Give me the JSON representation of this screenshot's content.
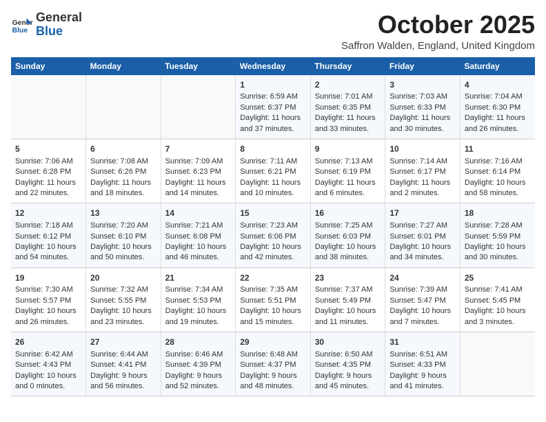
{
  "header": {
    "logo_general": "General",
    "logo_blue": "Blue",
    "month": "October 2025",
    "location": "Saffron Walden, England, United Kingdom"
  },
  "days_of_week": [
    "Sunday",
    "Monday",
    "Tuesday",
    "Wednesday",
    "Thursday",
    "Friday",
    "Saturday"
  ],
  "weeks": [
    [
      {
        "day": "",
        "text": ""
      },
      {
        "day": "",
        "text": ""
      },
      {
        "day": "",
        "text": ""
      },
      {
        "day": "1",
        "text": "Sunrise: 6:59 AM\nSunset: 6:37 PM\nDaylight: 11 hours and 37 minutes."
      },
      {
        "day": "2",
        "text": "Sunrise: 7:01 AM\nSunset: 6:35 PM\nDaylight: 11 hours and 33 minutes."
      },
      {
        "day": "3",
        "text": "Sunrise: 7:03 AM\nSunset: 6:33 PM\nDaylight: 11 hours and 30 minutes."
      },
      {
        "day": "4",
        "text": "Sunrise: 7:04 AM\nSunset: 6:30 PM\nDaylight: 11 hours and 26 minutes."
      }
    ],
    [
      {
        "day": "5",
        "text": "Sunrise: 7:06 AM\nSunset: 6:28 PM\nDaylight: 11 hours and 22 minutes."
      },
      {
        "day": "6",
        "text": "Sunrise: 7:08 AM\nSunset: 6:26 PM\nDaylight: 11 hours and 18 minutes."
      },
      {
        "day": "7",
        "text": "Sunrise: 7:09 AM\nSunset: 6:23 PM\nDaylight: 11 hours and 14 minutes."
      },
      {
        "day": "8",
        "text": "Sunrise: 7:11 AM\nSunset: 6:21 PM\nDaylight: 11 hours and 10 minutes."
      },
      {
        "day": "9",
        "text": "Sunrise: 7:13 AM\nSunset: 6:19 PM\nDaylight: 11 hours and 6 minutes."
      },
      {
        "day": "10",
        "text": "Sunrise: 7:14 AM\nSunset: 6:17 PM\nDaylight: 11 hours and 2 minutes."
      },
      {
        "day": "11",
        "text": "Sunrise: 7:16 AM\nSunset: 6:14 PM\nDaylight: 10 hours and 58 minutes."
      }
    ],
    [
      {
        "day": "12",
        "text": "Sunrise: 7:18 AM\nSunset: 6:12 PM\nDaylight: 10 hours and 54 minutes."
      },
      {
        "day": "13",
        "text": "Sunrise: 7:20 AM\nSunset: 6:10 PM\nDaylight: 10 hours and 50 minutes."
      },
      {
        "day": "14",
        "text": "Sunrise: 7:21 AM\nSunset: 6:08 PM\nDaylight: 10 hours and 46 minutes."
      },
      {
        "day": "15",
        "text": "Sunrise: 7:23 AM\nSunset: 6:06 PM\nDaylight: 10 hours and 42 minutes."
      },
      {
        "day": "16",
        "text": "Sunrise: 7:25 AM\nSunset: 6:03 PM\nDaylight: 10 hours and 38 minutes."
      },
      {
        "day": "17",
        "text": "Sunrise: 7:27 AM\nSunset: 6:01 PM\nDaylight: 10 hours and 34 minutes."
      },
      {
        "day": "18",
        "text": "Sunrise: 7:28 AM\nSunset: 5:59 PM\nDaylight: 10 hours and 30 minutes."
      }
    ],
    [
      {
        "day": "19",
        "text": "Sunrise: 7:30 AM\nSunset: 5:57 PM\nDaylight: 10 hours and 26 minutes."
      },
      {
        "day": "20",
        "text": "Sunrise: 7:32 AM\nSunset: 5:55 PM\nDaylight: 10 hours and 23 minutes."
      },
      {
        "day": "21",
        "text": "Sunrise: 7:34 AM\nSunset: 5:53 PM\nDaylight: 10 hours and 19 minutes."
      },
      {
        "day": "22",
        "text": "Sunrise: 7:35 AM\nSunset: 5:51 PM\nDaylight: 10 hours and 15 minutes."
      },
      {
        "day": "23",
        "text": "Sunrise: 7:37 AM\nSunset: 5:49 PM\nDaylight: 10 hours and 11 minutes."
      },
      {
        "day": "24",
        "text": "Sunrise: 7:39 AM\nSunset: 5:47 PM\nDaylight: 10 hours and 7 minutes."
      },
      {
        "day": "25",
        "text": "Sunrise: 7:41 AM\nSunset: 5:45 PM\nDaylight: 10 hours and 3 minutes."
      }
    ],
    [
      {
        "day": "26",
        "text": "Sunrise: 6:42 AM\nSunset: 4:43 PM\nDaylight: 10 hours and 0 minutes."
      },
      {
        "day": "27",
        "text": "Sunrise: 6:44 AM\nSunset: 4:41 PM\nDaylight: 9 hours and 56 minutes."
      },
      {
        "day": "28",
        "text": "Sunrise: 6:46 AM\nSunset: 4:39 PM\nDaylight: 9 hours and 52 minutes."
      },
      {
        "day": "29",
        "text": "Sunrise: 6:48 AM\nSunset: 4:37 PM\nDaylight: 9 hours and 48 minutes."
      },
      {
        "day": "30",
        "text": "Sunrise: 6:50 AM\nSunset: 4:35 PM\nDaylight: 9 hours and 45 minutes."
      },
      {
        "day": "31",
        "text": "Sunrise: 6:51 AM\nSunset: 4:33 PM\nDaylight: 9 hours and 41 minutes."
      },
      {
        "day": "",
        "text": ""
      }
    ]
  ]
}
